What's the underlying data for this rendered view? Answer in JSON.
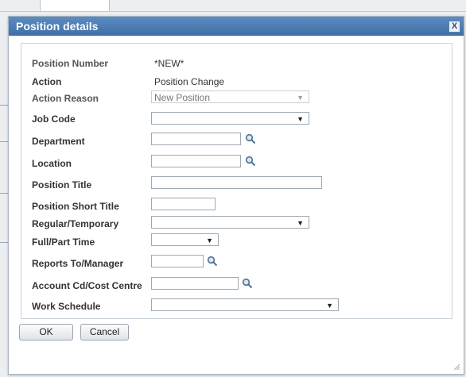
{
  "dialog": {
    "title": "Position details",
    "close_glyph": "X"
  },
  "form": {
    "position_number": {
      "label": "Position Number",
      "value": "*NEW*"
    },
    "action": {
      "label": "Action",
      "value": "Position Change"
    },
    "action_reason": {
      "label": "Action Reason",
      "value": "New Position"
    },
    "job_code": {
      "label": "Job Code",
      "value": ""
    },
    "department": {
      "label": "Department",
      "value": ""
    },
    "location": {
      "label": "Location",
      "value": ""
    },
    "position_title": {
      "label": "Position Title",
      "value": ""
    },
    "position_short_title": {
      "label": "Position Short Title",
      "value": ""
    },
    "regular_temporary": {
      "label": "Regular/Temporary",
      "value": ""
    },
    "full_part_time": {
      "label": "Full/Part Time",
      "value": ""
    },
    "reports_to_manager": {
      "label": "Reports To/Manager",
      "value": ""
    },
    "account_cost_centre": {
      "label": "Account Cd/Cost Centre",
      "value": ""
    },
    "work_schedule": {
      "label": "Work Schedule",
      "value": ""
    }
  },
  "buttons": {
    "ok_label": "OK",
    "cancel_label": "Cancel"
  },
  "icons": {
    "dropdown": "chevron-down-icon",
    "lookup": "search-icon",
    "close": "close-icon"
  },
  "colors": {
    "titlebar": "#4a7bb4",
    "label_text": "#333333",
    "field_border": "#9ea9b3"
  }
}
